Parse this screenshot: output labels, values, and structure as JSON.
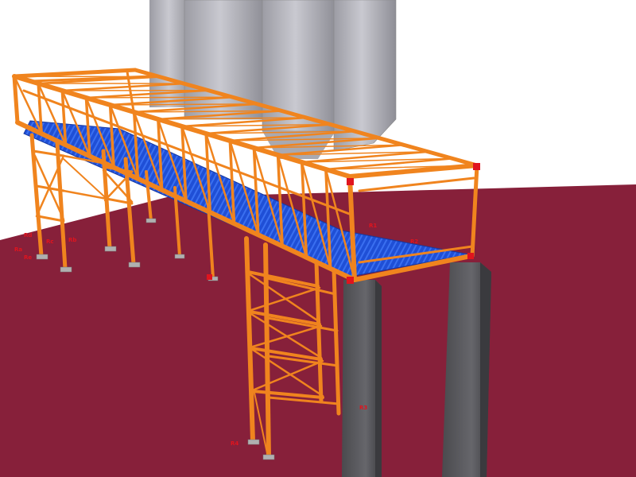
{
  "viewport": {
    "background": "#ffffff",
    "ground_color": "#87203a",
    "steel_color": "#f0841e",
    "steel_dark": "#b85a0c",
    "deck_color": "#1f4fd6",
    "silo_color": "#b8b8bf",
    "pier_color": "#58585c",
    "label_color": "#e0141e"
  },
  "support_labels": [
    "Rd",
    "Rc",
    "Rb",
    "Ra",
    "Re",
    "R4",
    "R3",
    "R2",
    "R1"
  ]
}
